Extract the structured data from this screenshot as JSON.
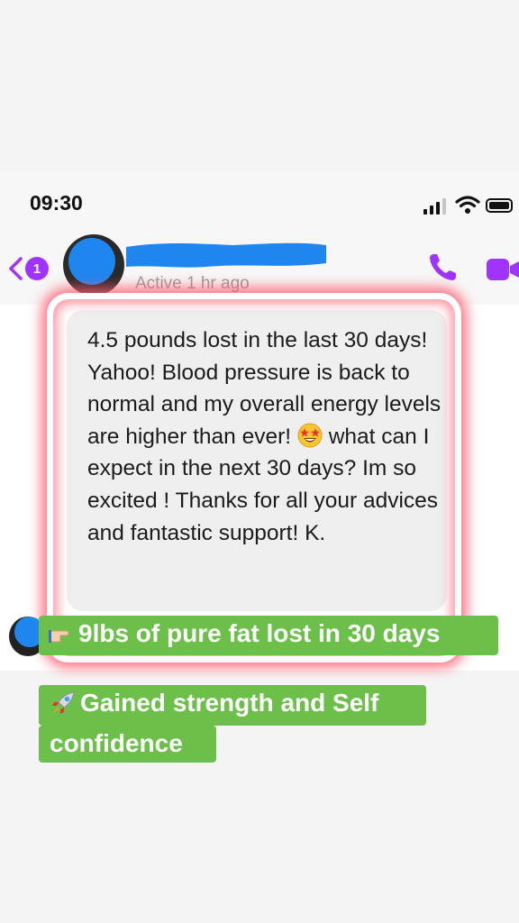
{
  "status_bar": {
    "time": "09:30",
    "icons": [
      "cellular-signal-icon",
      "wifi-icon",
      "battery-icon"
    ]
  },
  "header": {
    "back_badge": "1",
    "active_status": "Active 1 hr ago",
    "icons": [
      "back-chevron-icon",
      "phone-icon",
      "video-icon"
    ]
  },
  "message": {
    "text": "4.5 pounds lost in the last 30 days! Yahoo! Blood pressure is back to normal and my overall energy levels are higher than ever! ",
    "emoji": "star-struck-face-icon",
    "text_after_emoji": " what can I expect in the next 30 days? Im so excited ! Thanks for all your advices and fantastic support! K."
  },
  "labels": [
    {
      "emoji": "pointing-hand-icon",
      "text": "9lbs of pure fat lost in 30 days"
    },
    {
      "emoji": "rocket-icon",
      "text": "Gained strength and Self",
      "text2": "confidence"
    }
  ],
  "colors": {
    "accent": "#a033ff",
    "label_green": "#6cc04a",
    "highlight": "#ff5a6e",
    "redaction_blue": "#1f86f0"
  }
}
